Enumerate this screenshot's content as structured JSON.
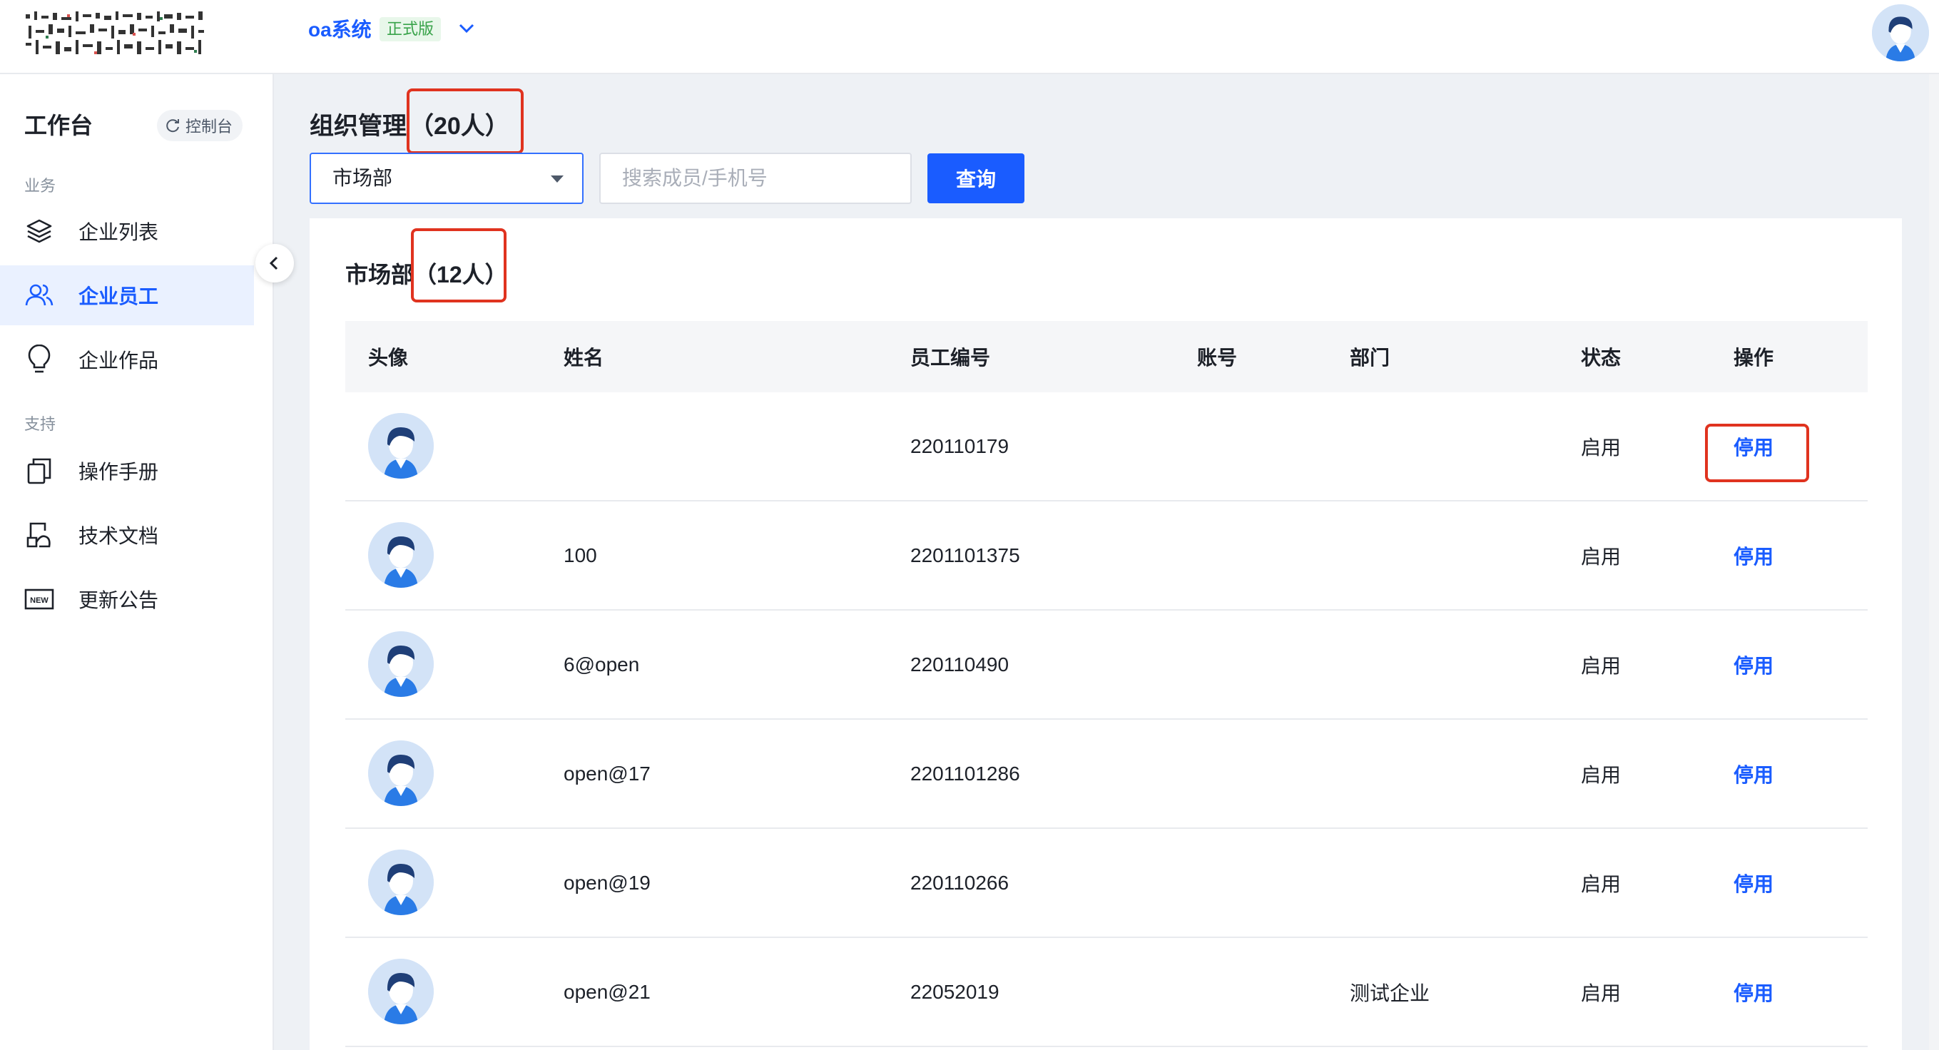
{
  "header": {
    "system_name": "oa系统",
    "edition_badge": "正式版",
    "chevron_icon": "chevron-down-icon",
    "avatar_icon": "user-avatar-icon"
  },
  "sidebar": {
    "workspace_title": "工作台",
    "console_label": "控制台",
    "console_icon": "refresh-icon",
    "sections": [
      {
        "label": "业务"
      },
      {
        "label": "支持"
      }
    ],
    "items": [
      {
        "label": "企业列表",
        "icon": "layers-icon",
        "active": false
      },
      {
        "label": "企业员工",
        "icon": "users-icon",
        "active": true
      },
      {
        "label": "企业作品",
        "icon": "lightbulb-icon",
        "active": false
      },
      {
        "label": "操作手册",
        "icon": "copy-document-icon",
        "active": false
      },
      {
        "label": "技术文档",
        "icon": "document-hand-icon",
        "active": false
      },
      {
        "label": "更新公告",
        "icon": "new-badge-icon",
        "active": false
      }
    ]
  },
  "main": {
    "page_title": "组织管理",
    "total_count": "（20人）",
    "dept_select_value": "市场部",
    "search_placeholder": "搜索成员/手机号",
    "query_button": "查询",
    "panel_title": "市场部",
    "panel_count": "（12人）",
    "table": {
      "columns": [
        "头像",
        "姓名",
        "员工编号",
        "账号",
        "部门",
        "状态",
        "操作"
      ],
      "rows": [
        {
          "name": "",
          "employee_no": "220110179",
          "account": "",
          "department": "",
          "status": "启用",
          "action": "停用"
        },
        {
          "name": "100",
          "employee_no": "2201101375",
          "account": "",
          "department": "",
          "status": "启用",
          "action": "停用"
        },
        {
          "name": "6@open",
          "employee_no": "220110490",
          "account": "",
          "department": "",
          "status": "启用",
          "action": "停用"
        },
        {
          "name": "open@17",
          "employee_no": "2201101286",
          "account": "",
          "department": "",
          "status": "启用",
          "action": "停用"
        },
        {
          "name": "open@19",
          "employee_no": "220110266",
          "account": "",
          "department": "",
          "status": "启用",
          "action": "停用"
        },
        {
          "name": "open@21",
          "employee_no": "22052019",
          "account": "",
          "department": "测试企业",
          "status": "启用",
          "action": "停用"
        }
      ]
    }
  },
  "colors": {
    "accent": "#1a5cff",
    "highlight_box": "#e0331f",
    "badge_green": "#39a34a"
  }
}
